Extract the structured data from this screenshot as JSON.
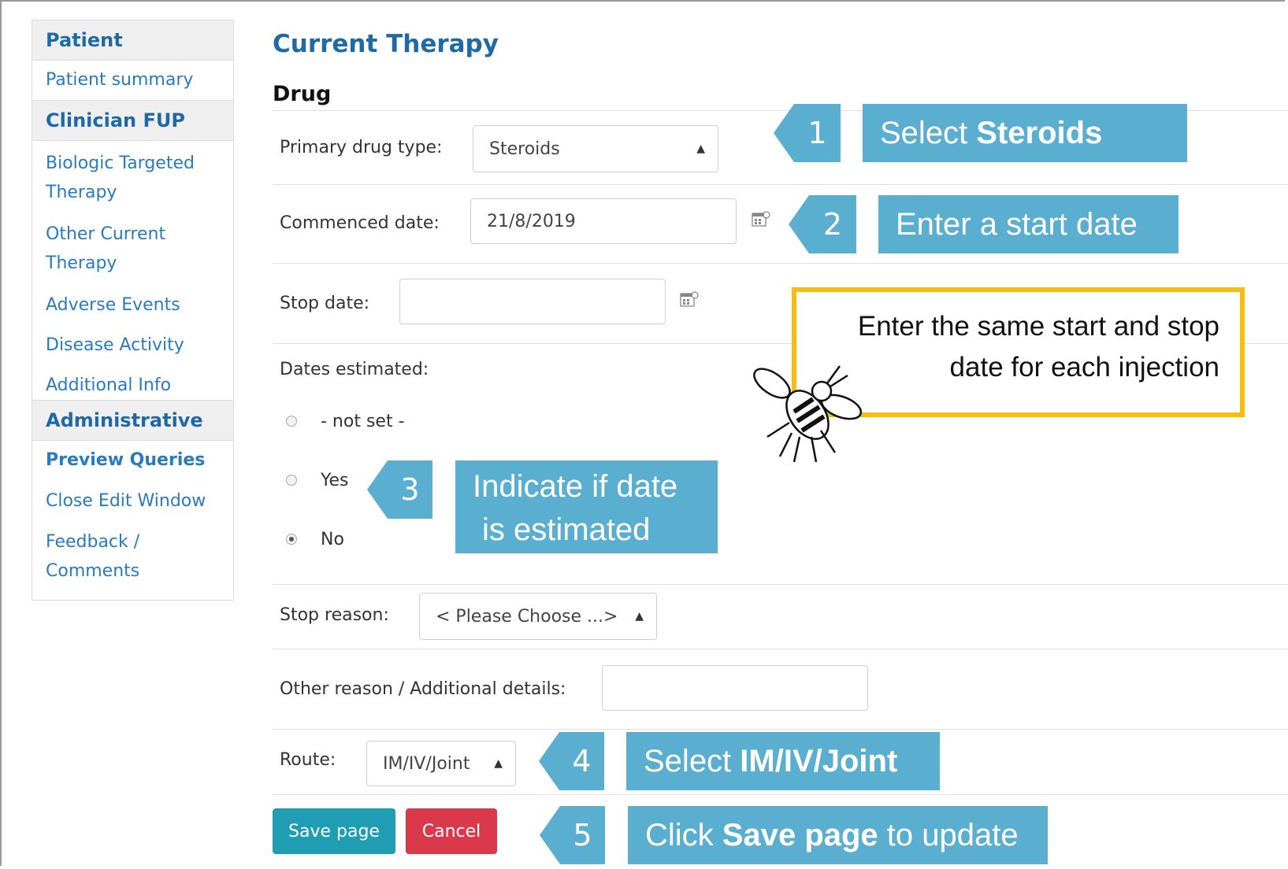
{
  "sidebar": {
    "sections": [
      {
        "title": "Patient",
        "items": [
          {
            "label": "Patient summary"
          }
        ]
      },
      {
        "title": "Clinician FUP",
        "items": [
          {
            "label": "Biologic Targeted Therapy"
          },
          {
            "label": "Other Current Therapy"
          },
          {
            "label": "Adverse Events"
          },
          {
            "label": "Disease Activity"
          },
          {
            "label": "Additional Info"
          }
        ]
      },
      {
        "title": "Administrative",
        "items": [
          {
            "label": "Preview Queries"
          },
          {
            "label": "Close Edit Window"
          },
          {
            "label": "Feedback / Comments"
          }
        ]
      }
    ]
  },
  "main": {
    "title": "Current Therapy",
    "section": "Drug",
    "primary_drug_type": {
      "label": "Primary drug type:",
      "value": "Steroids"
    },
    "commenced_date": {
      "label": "Commenced date:",
      "value": "21/8/2019"
    },
    "stop_date": {
      "label": "Stop date:",
      "value": ""
    },
    "dates_estimated": {
      "label": "Dates estimated:",
      "options": [
        "- not set -",
        "Yes",
        "No"
      ],
      "selected": "No"
    },
    "stop_reason": {
      "label": "Stop reason:",
      "value": "< Please Choose ...>"
    },
    "other_reason": {
      "label": "Other reason / Additional details:",
      "value": ""
    },
    "route": {
      "label": "Route:",
      "value": "IM/IV/Joint"
    },
    "save_label": "Save page",
    "cancel_label": "Cancel"
  },
  "callouts": [
    {
      "num": "1",
      "pre": "Select ",
      "bold": "Steroids",
      "post": ""
    },
    {
      "num": "2",
      "pre": "Enter a start date",
      "bold": "",
      "post": ""
    },
    {
      "num": "3",
      "line1": "Indicate if date",
      "line2": "is estimated"
    },
    {
      "num": "4",
      "pre": "Select ",
      "bold": "IM/IV/Joint",
      "post": ""
    },
    {
      "num": "5",
      "pre": "Click ",
      "bold": "Save page",
      "post": " to update"
    }
  ],
  "note": "Enter the same start and stop date for each injection",
  "colors": {
    "accent": "#5aaed0",
    "link": "#2a7bbd",
    "heading": "#1f6aa5",
    "save": "#1f9eb3",
    "cancel": "#d9394a",
    "note_border": "#f5be14"
  },
  "icons": {
    "calendar": "calendar-icon",
    "bee": "bee-icon"
  }
}
